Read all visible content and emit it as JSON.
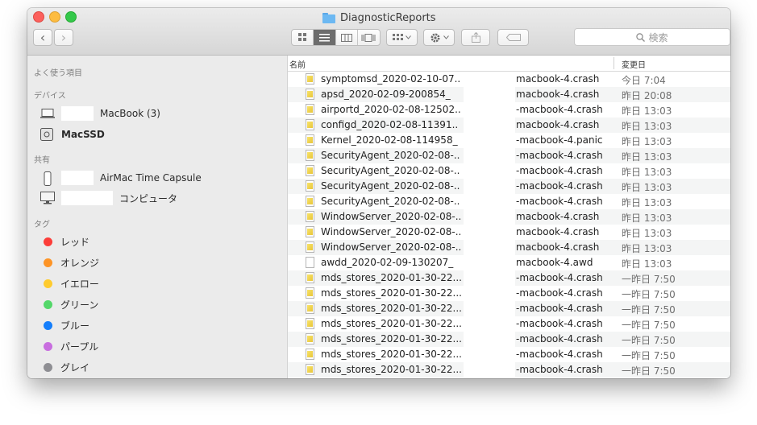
{
  "window": {
    "title": "DiagnosticReports"
  },
  "toolbar": {
    "back": "‹",
    "forward": "›",
    "search_placeholder": "検索"
  },
  "sidebar": {
    "favorites_header": "よく使う項目",
    "devices_header": "デバイス",
    "devices": [
      {
        "label": "MacBook (3)",
        "icon": "laptop-icon"
      },
      {
        "label": "MacSSD",
        "icon": "disk-icon"
      }
    ],
    "shared_header": "共有",
    "shared": [
      {
        "label": "AirMac Time Capsule",
        "icon": "time-capsule-icon"
      },
      {
        "label": "コンピュータ",
        "icon": "display-icon"
      }
    ],
    "tags_header": "タグ",
    "tags": [
      {
        "label": "レッド",
        "color": "#fc3d39"
      },
      {
        "label": "オレンジ",
        "color": "#fd9426"
      },
      {
        "label": "イエロー",
        "color": "#fecb2e"
      },
      {
        "label": "グリーン",
        "color": "#53d769"
      },
      {
        "label": "ブルー",
        "color": "#147efb"
      },
      {
        "label": "パープル",
        "color": "#c86edf"
      },
      {
        "label": "グレイ",
        "color": "#8e8e93"
      }
    ]
  },
  "columns": {
    "name": "名前",
    "modified": "変更日"
  },
  "files": [
    {
      "name": "symptomsd_2020-02-10-07..",
      "suffix": "macbook-4.crash",
      "date": "今日 7:04",
      "type": "crash"
    },
    {
      "name": "apsd_2020-02-09-200854_",
      "suffix": "macbook-4.crash",
      "date": "昨日 20:08",
      "type": "crash"
    },
    {
      "name": "airportd_2020-02-08-12502..",
      "suffix": "-macbook-4.crash",
      "date": "昨日 13:03",
      "type": "crash"
    },
    {
      "name": "configd_2020-02-08-11391..",
      "suffix": "macbook-4.crash",
      "date": "昨日 13:03",
      "type": "crash"
    },
    {
      "name": "Kernel_2020-02-08-114958_",
      "suffix": "-macbook-4.panic",
      "date": "昨日 13:03",
      "type": "crash"
    },
    {
      "name": "SecurityAgent_2020-02-08-..",
      "suffix": "-macbook-4.crash",
      "date": "昨日 13:03",
      "type": "crash"
    },
    {
      "name": "SecurityAgent_2020-02-08-..",
      "suffix": "-macbook-4.crash",
      "date": "昨日 13:03",
      "type": "crash"
    },
    {
      "name": "SecurityAgent_2020-02-08-..",
      "suffix": "-macbook-4.crash",
      "date": "昨日 13:03",
      "type": "crash"
    },
    {
      "name": "SecurityAgent_2020-02-08-..",
      "suffix": "-macbook-4.crash",
      "date": "昨日 13:03",
      "type": "crash"
    },
    {
      "name": "WindowServer_2020-02-08-..",
      "suffix": "macbook-4.crash",
      "date": "昨日 13:03",
      "type": "crash"
    },
    {
      "name": "WindowServer_2020-02-08-..",
      "suffix": "macbook-4.crash",
      "date": "昨日 13:03",
      "type": "crash"
    },
    {
      "name": "WindowServer_2020-02-08-..",
      "suffix": "macbook-4.crash",
      "date": "昨日 13:03",
      "type": "crash"
    },
    {
      "name": "awdd_2020-02-09-130207_",
      "suffix": "macbook-4.awd",
      "date": "昨日 13:03",
      "type": "doc"
    },
    {
      "name": "mds_stores_2020-01-30-22...",
      "suffix": "-macbook-4.crash",
      "date": "一昨日 7:50",
      "type": "crash"
    },
    {
      "name": "mds_stores_2020-01-30-22...",
      "suffix": "-macbook-4.crash",
      "date": "一昨日 7:50",
      "type": "crash"
    },
    {
      "name": "mds_stores_2020-01-30-22...",
      "suffix": "-macbook-4.crash",
      "date": "一昨日 7:50",
      "type": "crash"
    },
    {
      "name": "mds_stores_2020-01-30-22...",
      "suffix": "-macbook-4.crash",
      "date": "一昨日 7:50",
      "type": "crash"
    },
    {
      "name": "mds_stores_2020-01-30-22...",
      "suffix": "-macbook-4.crash",
      "date": "一昨日 7:50",
      "type": "crash"
    },
    {
      "name": "mds_stores_2020-01-30-22...",
      "suffix": "-macbook-4.crash",
      "date": "一昨日 7:50",
      "type": "crash"
    },
    {
      "name": "mds_stores_2020-01-30-22...",
      "suffix": "-macbook-4.crash",
      "date": "一昨日 7:50",
      "type": "crash"
    }
  ]
}
